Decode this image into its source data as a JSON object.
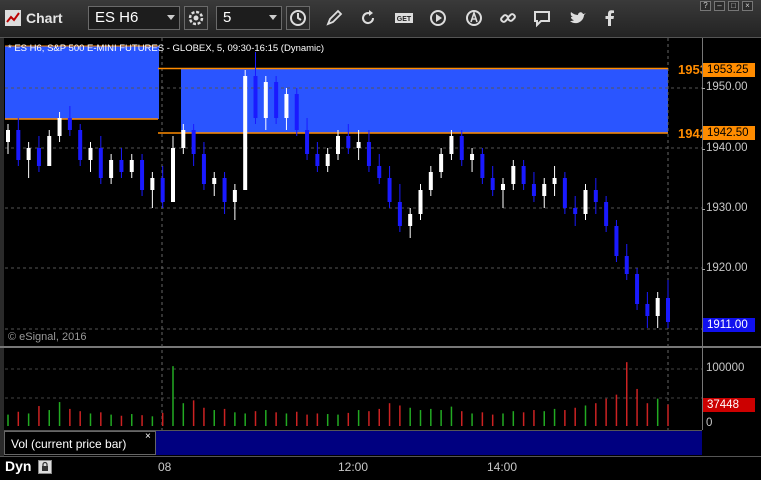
{
  "window": {
    "title": "Chart",
    "controls": [
      "?",
      "–",
      "□",
      "×"
    ]
  },
  "toolbar": {
    "symbol": "ES H6",
    "interval": "5",
    "icons": [
      "settings-icon",
      "clock-icon",
      "draw-icon",
      "refresh-icon",
      "get-icon",
      "play-icon",
      "alert-icon",
      "link-icon",
      "chat-icon",
      "twitter-icon",
      "facebook-icon"
    ],
    "get_label": "GET"
  },
  "chart": {
    "header": "* ES H6, S&P 500 E-MINI FUTURES - GLOBEX, 5, 09:30-16:15 (Dynamic)",
    "copyright": "© eSignal, 2016",
    "price_axis_ticks": [
      "1950.00",
      "1940.00",
      "1930.00",
      "1920.00"
    ],
    "high_line_label": "1953",
    "high_price_tag": "1953.25",
    "low_line_label": "1942",
    "low_price_tag": "1942.50",
    "last_price_tag": "1911.00",
    "volume_ticks": [
      "100000",
      "0"
    ],
    "volume_tag": "37448",
    "volume_panel_label": "Vol (current price bar)",
    "time_ticks": [
      "08",
      "12:00",
      "14:00"
    ],
    "dyn_label": "Dyn"
  },
  "colors": {
    "up_candle": "#ffffff",
    "down_candle": "#1a1aff",
    "range_band": "#2a55ff",
    "level_line": "#ff8c00",
    "volume_up": "#22aa22",
    "volume_down": "#cc2222"
  },
  "chart_data": {
    "type": "candlestick",
    "title": "",
    "symbol": "ES H6",
    "interval_minutes": 5,
    "ylim": [
      1908,
      1960
    ],
    "y_ticks": [
      1920,
      1930,
      1940,
      1950
    ],
    "horizontal_levels": [
      1953.25,
      1942.5
    ],
    "last_price": 1911.0,
    "bars": [
      [
        1941,
        1944,
        1939,
        1943
      ],
      [
        1943,
        1945,
        1937,
        1938
      ],
      [
        1938,
        1941,
        1935,
        1940
      ],
      [
        1940,
        1942,
        1936,
        1937
      ],
      [
        1937,
        1943,
        1937,
        1942
      ],
      [
        1942,
        1946,
        1941,
        1945
      ],
      [
        1945,
        1947,
        1942,
        1943
      ],
      [
        1943,
        1944,
        1937,
        1938
      ],
      [
        1938,
        1941,
        1936,
        1940
      ],
      [
        1940,
        1942,
        1934,
        1935
      ],
      [
        1935,
        1939,
        1934,
        1938
      ],
      [
        1938,
        1940,
        1935,
        1936
      ],
      [
        1936,
        1939,
        1935,
        1938
      ],
      [
        1938,
        1939,
        1932,
        1933
      ],
      [
        1933,
        1936,
        1930,
        1935
      ],
      [
        1935,
        1937,
        1930,
        1931
      ],
      [
        1931,
        1942,
        1931,
        1940
      ],
      [
        1940,
        1944,
        1939,
        1943
      ],
      [
        1943,
        1944,
        1937,
        1939
      ],
      [
        1939,
        1941,
        1933,
        1934
      ],
      [
        1934,
        1936,
        1932,
        1935
      ],
      [
        1935,
        1936,
        1929,
        1931
      ],
      [
        1931,
        1934,
        1928,
        1933
      ],
      [
        1933,
        1953,
        1933,
        1952
      ],
      [
        1952,
        1956,
        1944,
        1945
      ],
      [
        1945,
        1952,
        1943,
        1951
      ],
      [
        1951,
        1952,
        1944,
        1945
      ],
      [
        1945,
        1950,
        1943,
        1949
      ],
      [
        1949,
        1950,
        1942,
        1943
      ],
      [
        1943,
        1945,
        1938,
        1939
      ],
      [
        1939,
        1941,
        1936,
        1937
      ],
      [
        1937,
        1940,
        1936,
        1939
      ],
      [
        1939,
        1943,
        1938,
        1942
      ],
      [
        1942,
        1944,
        1939,
        1940
      ],
      [
        1940,
        1943,
        1938,
        1941
      ],
      [
        1941,
        1943,
        1936,
        1937
      ],
      [
        1937,
        1939,
        1934,
        1935
      ],
      [
        1935,
        1937,
        1930,
        1931
      ],
      [
        1931,
        1934,
        1926,
        1927
      ],
      [
        1927,
        1930,
        1925,
        1929
      ],
      [
        1929,
        1934,
        1928,
        1933
      ],
      [
        1933,
        1937,
        1932,
        1936
      ],
      [
        1936,
        1940,
        1935,
        1939
      ],
      [
        1939,
        1943,
        1938,
        1942
      ],
      [
        1942,
        1943,
        1937,
        1938
      ],
      [
        1938,
        1940,
        1936,
        1939
      ],
      [
        1939,
        1940,
        1934,
        1935
      ],
      [
        1935,
        1937,
        1932,
        1933
      ],
      [
        1933,
        1935,
        1930,
        1934
      ],
      [
        1934,
        1938,
        1933,
        1937
      ],
      [
        1937,
        1938,
        1933,
        1934
      ],
      [
        1934,
        1936,
        1931,
        1932
      ],
      [
        1932,
        1935,
        1930,
        1934
      ],
      [
        1934,
        1937,
        1932,
        1935
      ],
      [
        1935,
        1936,
        1929,
        1930
      ],
      [
        1930,
        1932,
        1927,
        1929
      ],
      [
        1929,
        1934,
        1928,
        1933
      ],
      [
        1933,
        1935,
        1929,
        1931
      ],
      [
        1931,
        1932,
        1926,
        1927
      ],
      [
        1927,
        1928,
        1921,
        1922
      ],
      [
        1922,
        1924,
        1918,
        1919
      ],
      [
        1919,
        1920,
        1913,
        1914
      ],
      [
        1914,
        1916,
        1910,
        1912
      ],
      [
        1912,
        1916,
        1910,
        1915
      ],
      [
        1915,
        1918,
        1910,
        1911
      ]
    ],
    "volume_ylim": [
      0,
      120000
    ],
    "volume_ticks": [
      0,
      100000
    ],
    "last_volume": 37448,
    "volumes": [
      20000,
      25000,
      22000,
      35000,
      28000,
      42000,
      30000,
      26000,
      22000,
      24000,
      20000,
      18000,
      21000,
      19000,
      17000,
      23000,
      105000,
      40000,
      45000,
      32000,
      28000,
      30000,
      24000,
      22000,
      26000,
      28000,
      24000,
      22000,
      25000,
      20000,
      22000,
      21000,
      20000,
      23000,
      28000,
      26000,
      30000,
      40000,
      36000,
      32000,
      28000,
      30000,
      28000,
      34000,
      26000,
      22000,
      24000,
      20000,
      22000,
      26000,
      24000,
      28000,
      26000,
      30000,
      28000,
      32000,
      36000,
      40000,
      48000,
      55000,
      112000,
      65000,
      40000,
      48000,
      37448
    ],
    "x_ticks": [
      "08",
      "12:00",
      "14:00"
    ]
  }
}
